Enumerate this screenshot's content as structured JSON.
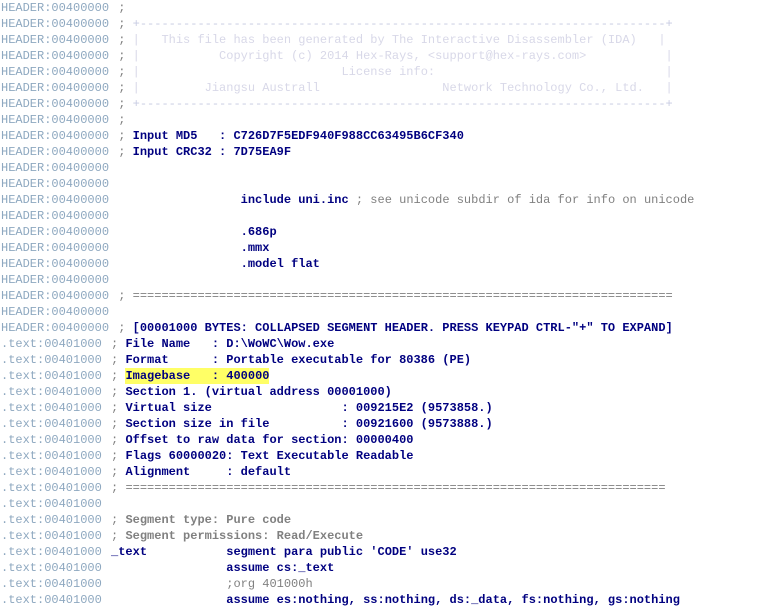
{
  "header_addr": "HEADER:00400000",
  "text_addr": ".text:00401000",
  "hdr_divider_top": "+-------------------------------------------------------------------------+",
  "hdr_box1": "|   This file has been generated by The Interactive Disassembler (IDA)   |",
  "hdr_box2": "|           Copyright (c) 2014 Hex-Rays, <support@hex-rays.com>           |",
  "hdr_box3": "|                            License info:                                |",
  "hdr_box4": "|         Jiangsu Australl                 Network Technology Co., Ltd.   |",
  "hdr_divider_bot": "+-------------------------------------------------------------------------+",
  "md5": "Input MD5   : C726D7F5EDF940F988CC63495B6CF340",
  "crc": "Input CRC32 : 7D75EA9F",
  "include_dir": "include",
  "include_file": "uni.inc",
  "include_cmt": " ; see unicode subdir of ida for info on unicode",
  "proc686": ".686p",
  "mmx": ".mmx",
  "model": ".model flat",
  "dashes": "===========================================================================",
  "collapsed": "[00001000 BYTES: COLLAPSED SEGMENT HEADER. PRESS KEYPAD CTRL-\"+\" TO EXPAND]",
  "file_name": "File Name   : D:\\WoWC\\Wow.exe",
  "format": "Format      : Portable executable for 80386 (PE)",
  "imagebase_k": "Imagebase   : ",
  "imagebase_v": "400000",
  "section1": "Section 1. (virtual address 00001000)",
  "vsize": "Virtual size                  : 009215E2 (9573858.)",
  "ssize": "Section size in file          : 00921600 (9573888.)",
  "offset": "Offset to raw data for section: 00000400",
  "flags": "Flags 60000020: Text Executable Readable",
  "align": "Alignment     : default",
  "segtype": "Segment type: Pure code",
  "segperm": "Segment permissions: Read/Execute",
  "textseg_a": "_text",
  "textseg_b": "segment para public 'CODE' use32",
  "assume_cs_a": "assume",
  "assume_cs_b": "cs:_text",
  "org": ";org 401000h",
  "assume_rest_a": "assume",
  "assume_rest_b": "es:nothing, ss:nothing, ds:_data, fs:nothing, gs:nothing",
  "pad18": "                  ",
  "pad16": "                "
}
